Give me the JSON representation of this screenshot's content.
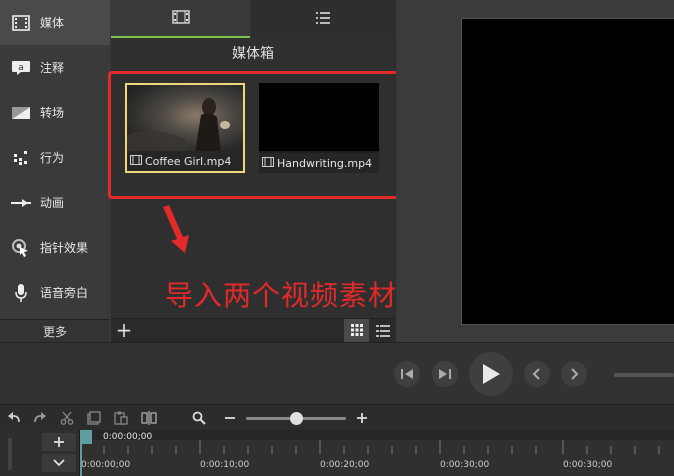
{
  "sidebar": {
    "items": [
      {
        "label": "媒体",
        "icon": "film-strip-icon"
      },
      {
        "label": "注释",
        "icon": "callout-icon"
      },
      {
        "label": "转场",
        "icon": "transition-icon"
      },
      {
        "label": "行为",
        "icon": "behavior-icon"
      },
      {
        "label": "动画",
        "icon": "animation-icon"
      },
      {
        "label": "指针效果",
        "icon": "cursor-effect-icon"
      },
      {
        "label": "语音旁白",
        "icon": "microphone-icon"
      }
    ],
    "more_label": "更多"
  },
  "media_bin": {
    "title": "媒体箱",
    "items": [
      {
        "name": "Coffee Girl.mp4"
      },
      {
        "name": "Handwriting.mp4"
      }
    ]
  },
  "annotation": {
    "text": "导入两个视频素材"
  },
  "timeline": {
    "playhead_time": "0:00:00;00",
    "ruler": [
      "0:00:00;00",
      "0:00:10;00",
      "0:00:20;00",
      "0:00:30;00",
      "0:00:30;00"
    ]
  },
  "colors": {
    "accent_green": "#7fc24a",
    "annotation_red": "#e32a2a",
    "selection_yellow": "#f0d77a"
  }
}
